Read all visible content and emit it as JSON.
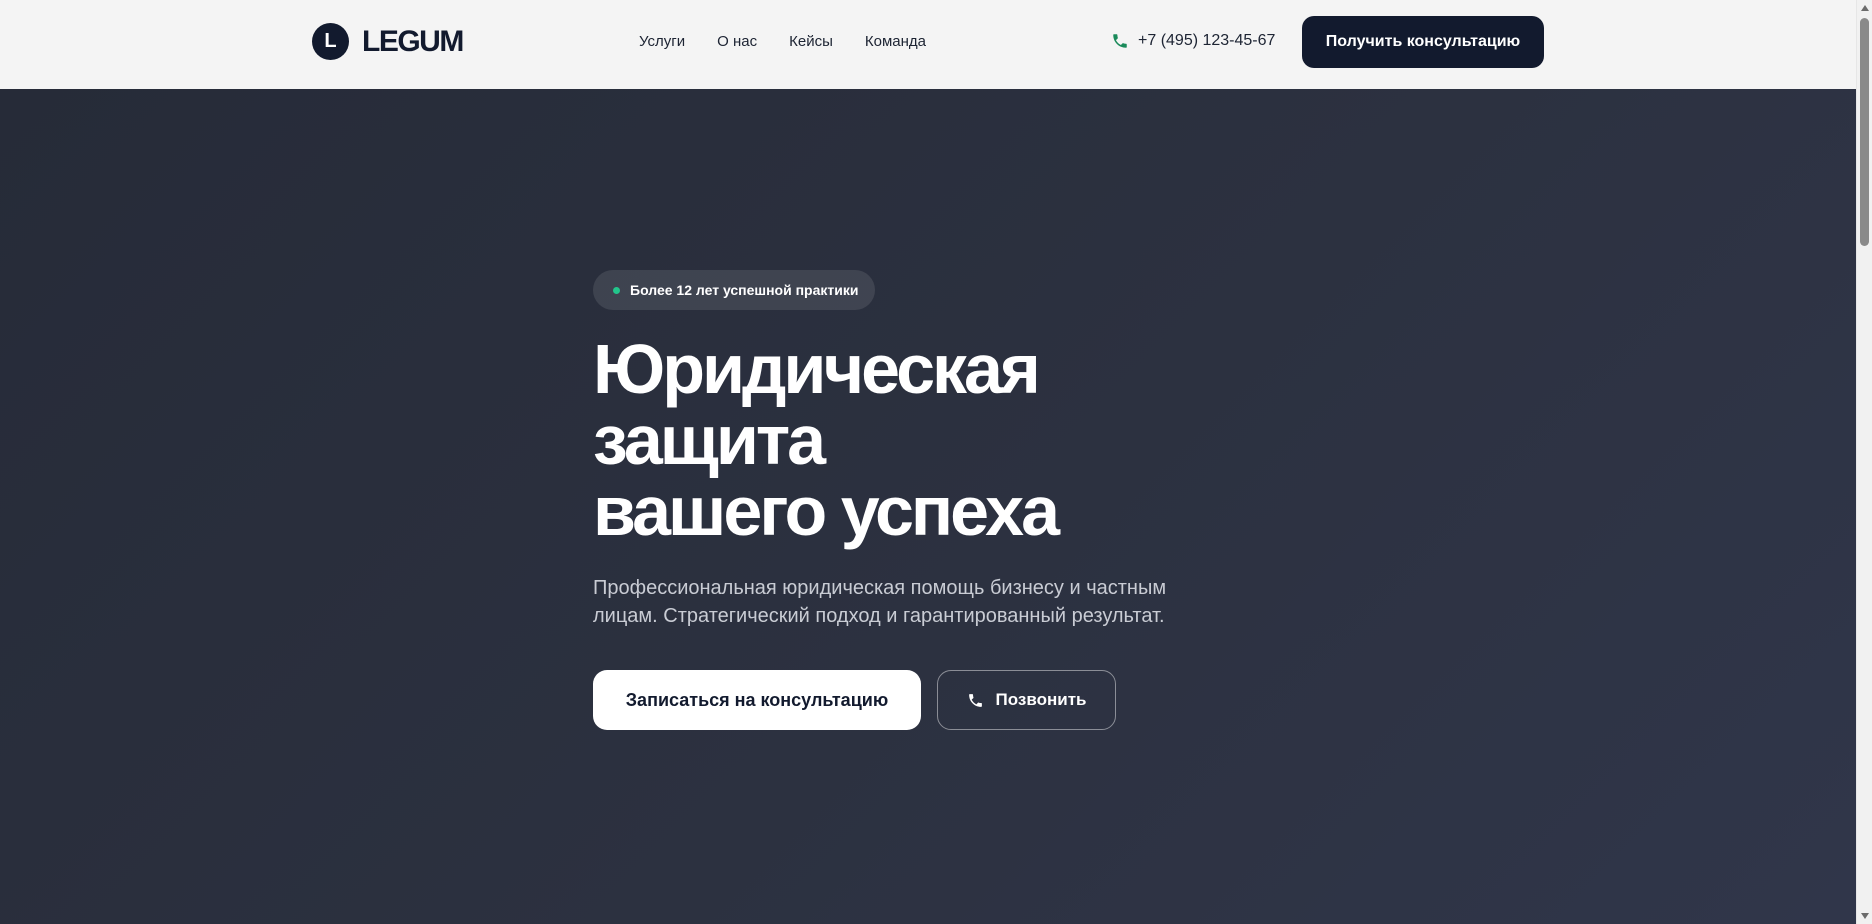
{
  "header": {
    "logo_letter": "L",
    "logo_text": "LEGUM",
    "nav": [
      {
        "label": "Услуги"
      },
      {
        "label": "О нас"
      },
      {
        "label": "Кейсы"
      },
      {
        "label": "Команда"
      }
    ],
    "phone": "+7 (495) 123-45-67",
    "cta_label": "Получить консультацию"
  },
  "hero": {
    "badge": "Более 12 лет успешной практики",
    "title_lines": [
      "Юридическая",
      "защита",
      "вашего успеха"
    ],
    "subtitle_lines": [
      "Профессиональная юридическая помощь бизнесу и частным",
      "лицам. Стратегический подход и гарантированный результат."
    ],
    "primary_button": "Записаться на консультацию",
    "secondary_button": "Позвонить"
  },
  "icons": {
    "phone": "phone-icon",
    "badge_dot": "status-dot-icon",
    "scroll_up": "arrow-up-icon",
    "scroll_down": "arrow-down-icon"
  },
  "colors": {
    "brand_dark": "#121a2e",
    "accent_green": "#22c58b",
    "phone_icon_green": "#1a8a5a",
    "hero_bg": "#2a2f3d",
    "header_bg": "#f4f4f4"
  }
}
